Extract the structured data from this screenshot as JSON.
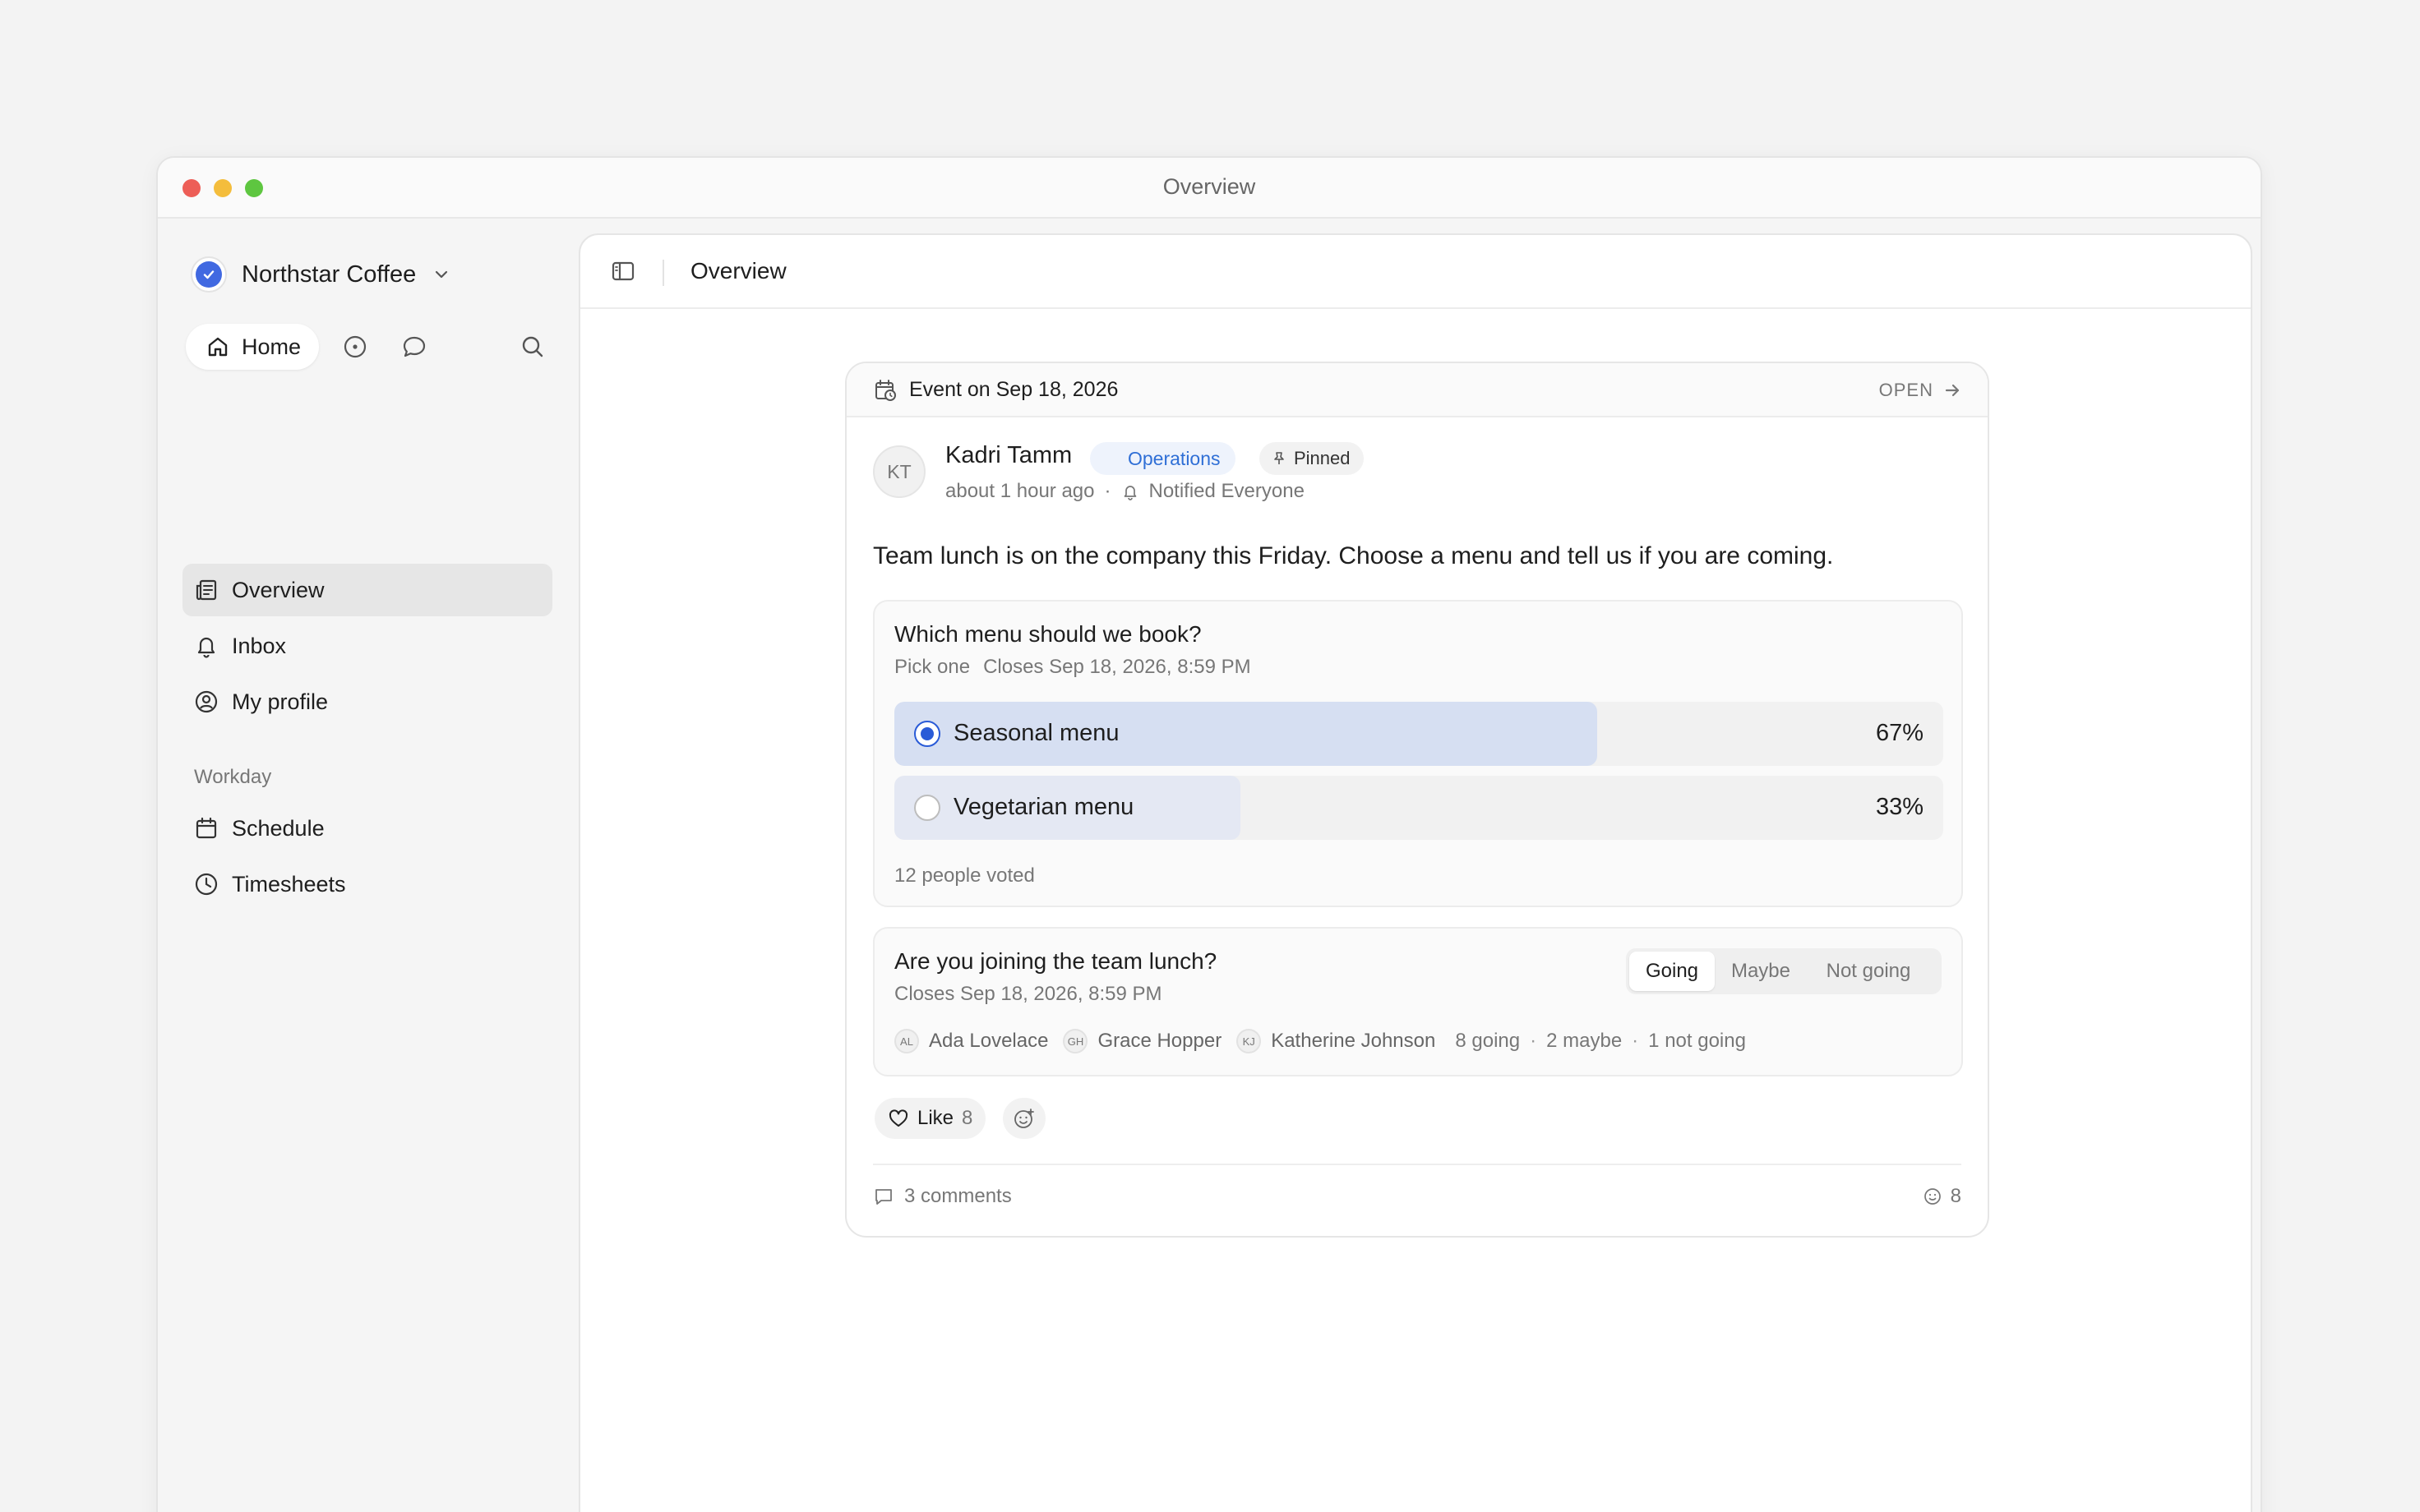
{
  "window": {
    "title": "Overview"
  },
  "sidebar": {
    "workspace_name": "Northstar Coffee",
    "home_label": "Home",
    "items": [
      {
        "label": "Overview",
        "icon": "newspaper-icon",
        "active": true
      },
      {
        "label": "Inbox",
        "icon": "bell-icon"
      },
      {
        "label": "My profile",
        "icon": "user-circle-icon"
      }
    ],
    "section_label": "Workday",
    "section_items": [
      {
        "label": "Schedule",
        "icon": "calendar-icon"
      },
      {
        "label": "Timesheets",
        "icon": "clock-icon"
      }
    ]
  },
  "main": {
    "title": "Overview",
    "post": {
      "event_label": "Event on Sep 18, 2026",
      "open_label": "OPEN",
      "avatar_initials": "KT",
      "author": "Kadri Tamm",
      "department": "Operations",
      "pinned_label": "Pinned",
      "time": "about 1 hour ago",
      "notified": "Notified Everyone",
      "body": "Team lunch is on the company this Friday. Choose a menu and tell us if you are coming.",
      "poll": {
        "question": "Which menu should we book?",
        "mode": "Pick one",
        "closes": "Closes Sep 18, 2026, 8:59 PM",
        "options": [
          {
            "label": "Seasonal menu",
            "percent_label": "67%",
            "share": 0.67,
            "selected": true
          },
          {
            "label": "Vegetarian menu",
            "percent_label": "33%",
            "share": 0.33,
            "selected": false
          }
        ],
        "votes": "12 people voted"
      },
      "rsvp": {
        "question": "Are you joining the team lunch?",
        "closes": "Closes Sep 18, 2026, 8:59 PM",
        "options": [
          "Going",
          "Maybe",
          "Not going"
        ],
        "selected": "Going",
        "attendees": [
          {
            "initials": "AL",
            "name": "Ada Lovelace"
          },
          {
            "initials": "GH",
            "name": "Grace Hopper"
          },
          {
            "initials": "KJ",
            "name": "Katherine Johnson"
          }
        ],
        "going": "8 going",
        "maybe": "2 maybe",
        "not_going": "1 not going"
      },
      "like_label": "Like",
      "like_count": "8",
      "comments": "3 comments",
      "reactions_count": "8"
    }
  },
  "colors": {
    "accent": "#2a5bd7",
    "poll_fill_selected": "#d6dff2",
    "poll_fill": "#e4e8f3",
    "badge_text": "#2f6fd6"
  }
}
